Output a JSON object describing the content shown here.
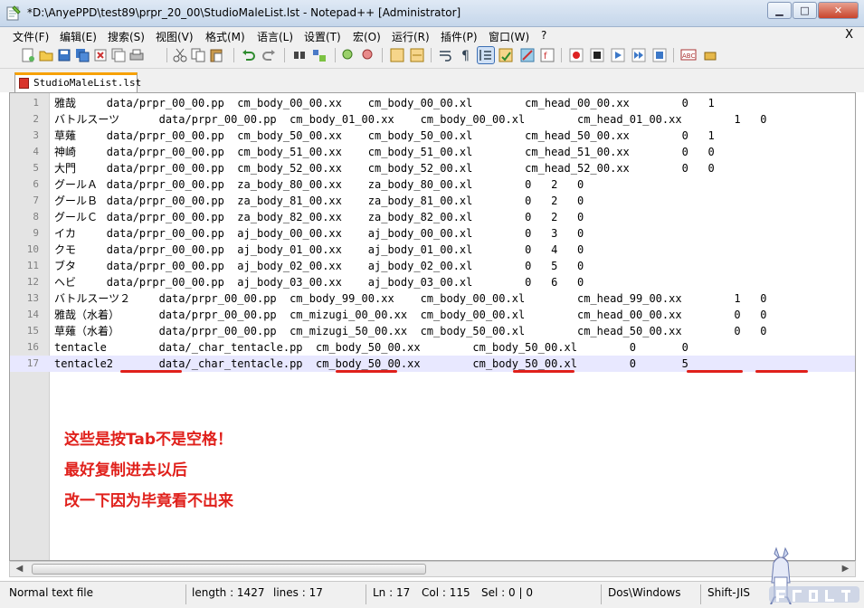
{
  "window": {
    "title": "*D:\\AnyePPD\\test89\\prpr_20_00\\StudioMaleList.lst - Notepad++ [Administrator]",
    "minimize": "▁",
    "maximize": "□",
    "close": "✕"
  },
  "menu": {
    "items": [
      "文件(F)",
      "编辑(E)",
      "搜索(S)",
      "视图(V)",
      "格式(M)",
      "语言(L)",
      "设置(T)",
      "宏(O)",
      "运行(R)",
      "插件(P)",
      "窗口(W)",
      "?"
    ],
    "close_label": "X"
  },
  "tab": {
    "label": "StudioMaleList.lst"
  },
  "editor": {
    "lines": [
      {
        "n": "1",
        "text": "雅哉\tdata/prpr_00_00.pp  cm_body_00_00.xx\tcm_body_00_00.xl\tcm_head_00_00.xx\t0   1"
      },
      {
        "n": "2",
        "text": "バトルスーツ\tdata/prpr_00_00.pp  cm_body_01_00.xx\tcm_body_00_00.xl\tcm_head_01_00.xx\t1   0"
      },
      {
        "n": "3",
        "text": "草薙\tdata/prpr_00_00.pp  cm_body_50_00.xx\tcm_body_50_00.xl\tcm_head_50_00.xx\t0   1"
      },
      {
        "n": "4",
        "text": "神崎\tdata/prpr_00_00.pp  cm_body_51_00.xx\tcm_body_51_00.xl\tcm_head_51_00.xx\t0   0"
      },
      {
        "n": "5",
        "text": "大門\tdata/prpr_00_00.pp  cm_body_52_00.xx\tcm_body_52_00.xl\tcm_head_52_00.xx\t0   0"
      },
      {
        "n": "6",
        "text": "グールＡ\tdata/prpr_00_00.pp  za_body_80_00.xx\tza_body_80_00.xl\t0   2   0"
      },
      {
        "n": "7",
        "text": "グールＢ\tdata/prpr_00_00.pp  za_body_81_00.xx\tza_body_81_00.xl\t0   2   0"
      },
      {
        "n": "8",
        "text": "グールＣ\tdata/prpr_00_00.pp  za_body_82_00.xx\tza_body_82_00.xl\t0   2   0"
      },
      {
        "n": "9",
        "text": "イカ\tdata/prpr_00_00.pp  aj_body_00_00.xx\taj_body_00_00.xl\t0   3   0"
      },
      {
        "n": "10",
        "text": "クモ\tdata/prpr_00_00.pp  aj_body_01_00.xx\taj_body_01_00.xl\t0   4   0"
      },
      {
        "n": "11",
        "text": "ブタ\tdata/prpr_00_00.pp  aj_body_02_00.xx\taj_body_02_00.xl\t0   5   0"
      },
      {
        "n": "12",
        "text": "ヘビ\tdata/prpr_00_00.pp  aj_body_03_00.xx\taj_body_03_00.xl\t0   6   0"
      },
      {
        "n": "13",
        "text": "バトルスーツ２\tdata/prpr_00_00.pp  cm_body_99_00.xx\tcm_body_00_00.xl\tcm_head_99_00.xx\t1   0"
      },
      {
        "n": "14",
        "text": "雅哉（水着）\tdata/prpr_00_00.pp  cm_mizugi_00_00.xx  cm_body_00_00.xl\tcm_head_00_00.xx\t0   0"
      },
      {
        "n": "15",
        "text": "草薙（水着）\tdata/prpr_00_00.pp  cm_mizugi_50_00.xx  cm_body_50_00.xl\tcm_head_50_00.xx\t0   0"
      },
      {
        "n": "16",
        "text": "tentacle\tdata/_char_tentacle.pp\tcm_body_50_00.xx\tcm_body_50_00.xl\t0\t0"
      },
      {
        "n": "17",
        "text": "tentacle2\tdata/_char_tentacle.pp\tcm_body_50_00.xx\tcm_body_50_00.xl\t0\t5"
      }
    ]
  },
  "annotation": {
    "line1": "这些是按Tab不是空格！",
    "line2": "最好复制进去以后",
    "line3": "改一下因为毕竟看不出来"
  },
  "status": {
    "file_type": "Normal text file",
    "length": "length : 1427",
    "lines": "lines : 17",
    "ln": "Ln : 17",
    "col": "Col : 115",
    "sel": "Sel : 0 | 0",
    "eol": "Dos\\Windows",
    "encoding": "Shift-JIS"
  },
  "colors": {
    "annotation_red": "#e0201b",
    "current_line": "#e8e8ff",
    "tab_accent": "#f7a100"
  }
}
